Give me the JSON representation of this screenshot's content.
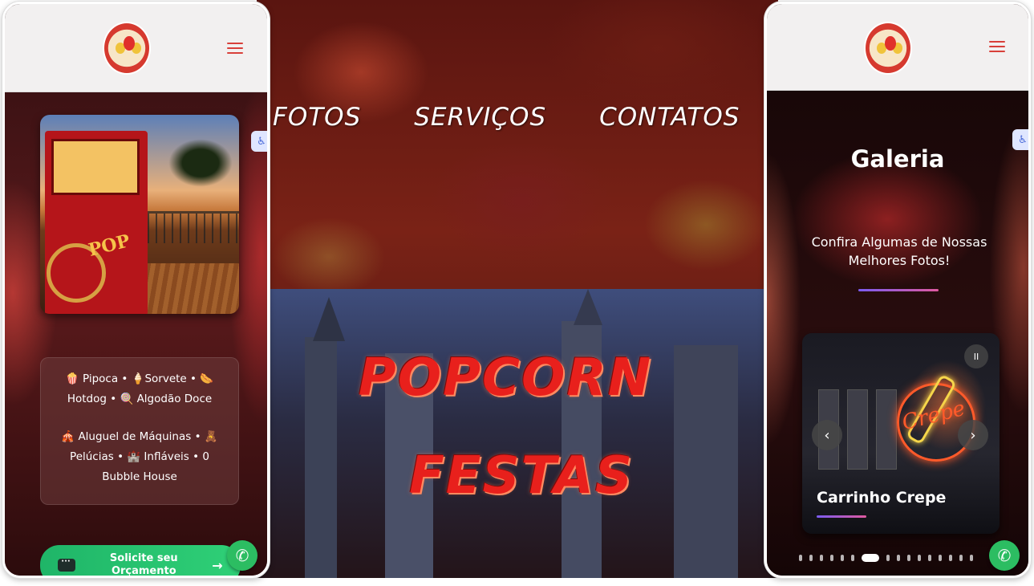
{
  "hero": {
    "nav": [
      "FOTOS",
      "SERVIÇOS",
      "CONTATOS"
    ],
    "title_line1": "POPCORN",
    "title_line2": "FESTAS"
  },
  "left_phone": {
    "services": {
      "line1": "🍿 Pipoca • 🍦Sorvete • 🌭 Hotdog • 🍭 Algodão Doce",
      "line2": "🎪 Aluguel de Máquinas • 🧸 Pelúcias • 🏰 Infláveis • 0 Bubble House"
    },
    "cta": {
      "label": "Solicite seu Orçamento",
      "arrow": "→"
    }
  },
  "right_phone": {
    "gallery_title": "Galeria",
    "gallery_subtitle": "Confira Algumas de Nossas Melhores Fotos!",
    "slide": {
      "caption": "Carrinho Crepe",
      "neon": "Crepe",
      "pause": "II",
      "prev": "‹",
      "next": "›"
    },
    "dots_total": 16,
    "active_dot_index": 6
  },
  "icons": {
    "menu": "hamburger-icon",
    "whatsapp": "whatsapp-icon",
    "accessibility": "accessibility-icon"
  },
  "colors": {
    "accent_red": "#d8403a",
    "cta_green": "#2fd077",
    "whatsapp_green": "#2cbd62"
  }
}
